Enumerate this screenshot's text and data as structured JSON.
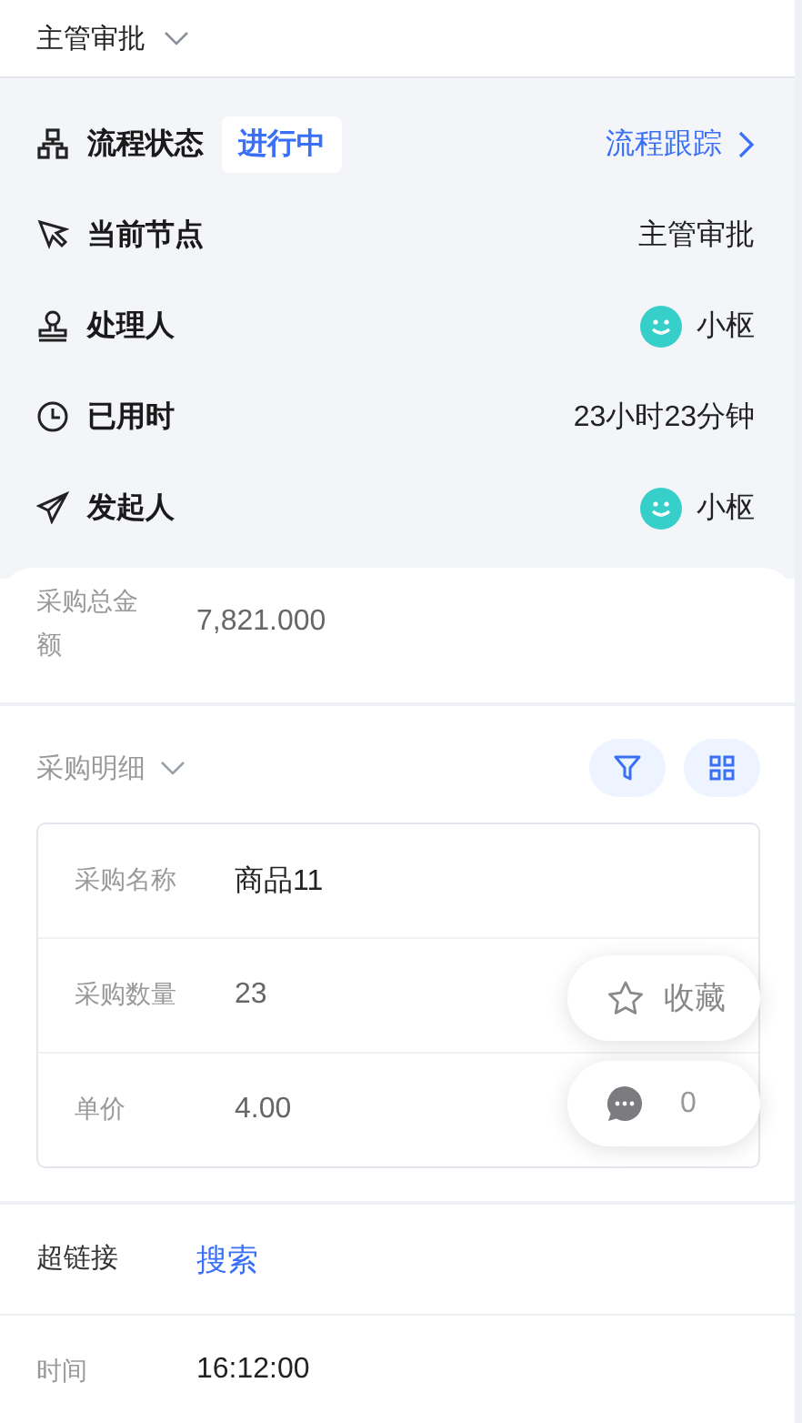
{
  "header": {
    "title": "主管审批"
  },
  "process": {
    "rows": [
      {
        "kind": "status",
        "label": "流程状态",
        "badge": "进行中",
        "link": "流程跟踪"
      },
      {
        "kind": "text",
        "label": "当前节点",
        "value": "主管审批"
      },
      {
        "kind": "user",
        "label": "处理人",
        "value": "小枢"
      },
      {
        "kind": "text",
        "label": "已用时",
        "value": "23小时23分钟"
      },
      {
        "kind": "user",
        "label": "发起人",
        "value": "小枢"
      }
    ]
  },
  "form": [
    {
      "kind": "field",
      "label": "采购总金额",
      "value": "7,821.000"
    },
    {
      "kind": "subtable",
      "label": "采购明细",
      "rows": [
        {
          "label": "采购名称",
          "value": "商品11"
        },
        {
          "label": "采购数量",
          "value": "23"
        },
        {
          "label": "单价",
          "value": "4.00"
        }
      ]
    },
    {
      "kind": "link",
      "label": "超链接",
      "value": "搜索"
    },
    {
      "kind": "field",
      "label": "时间",
      "value": "16:12:00"
    }
  ],
  "floating": {
    "favorite": "收藏",
    "comments": "0"
  }
}
